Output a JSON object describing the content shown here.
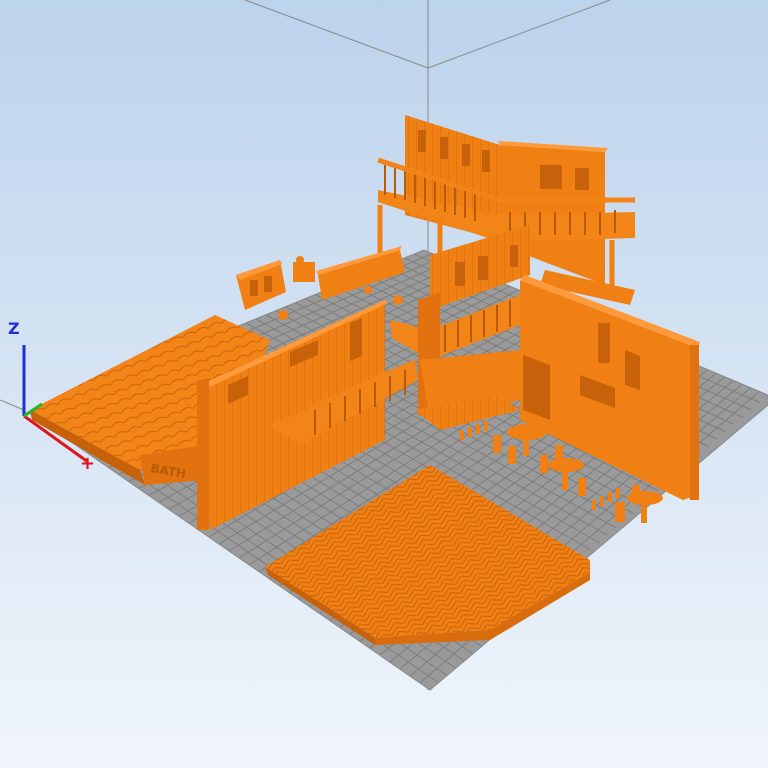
{
  "viewport": {
    "background_top": "#bcd3ec",
    "background_bottom": "#f0f5fb",
    "bed_color": "#9a9a9a",
    "bed_grid_color": "#7d7d7d",
    "model_color": "#f07f14",
    "model_shade": "#c8620a",
    "model_light": "#ff9a3a",
    "bounding_line_color": "#8a8a8a"
  },
  "axes": {
    "z_label": "Z",
    "x_label": "+",
    "z_color": "#1f2fd1",
    "x_color": "#e0161b",
    "y_color": "#2bb52b"
  },
  "sign_text": "BATH"
}
